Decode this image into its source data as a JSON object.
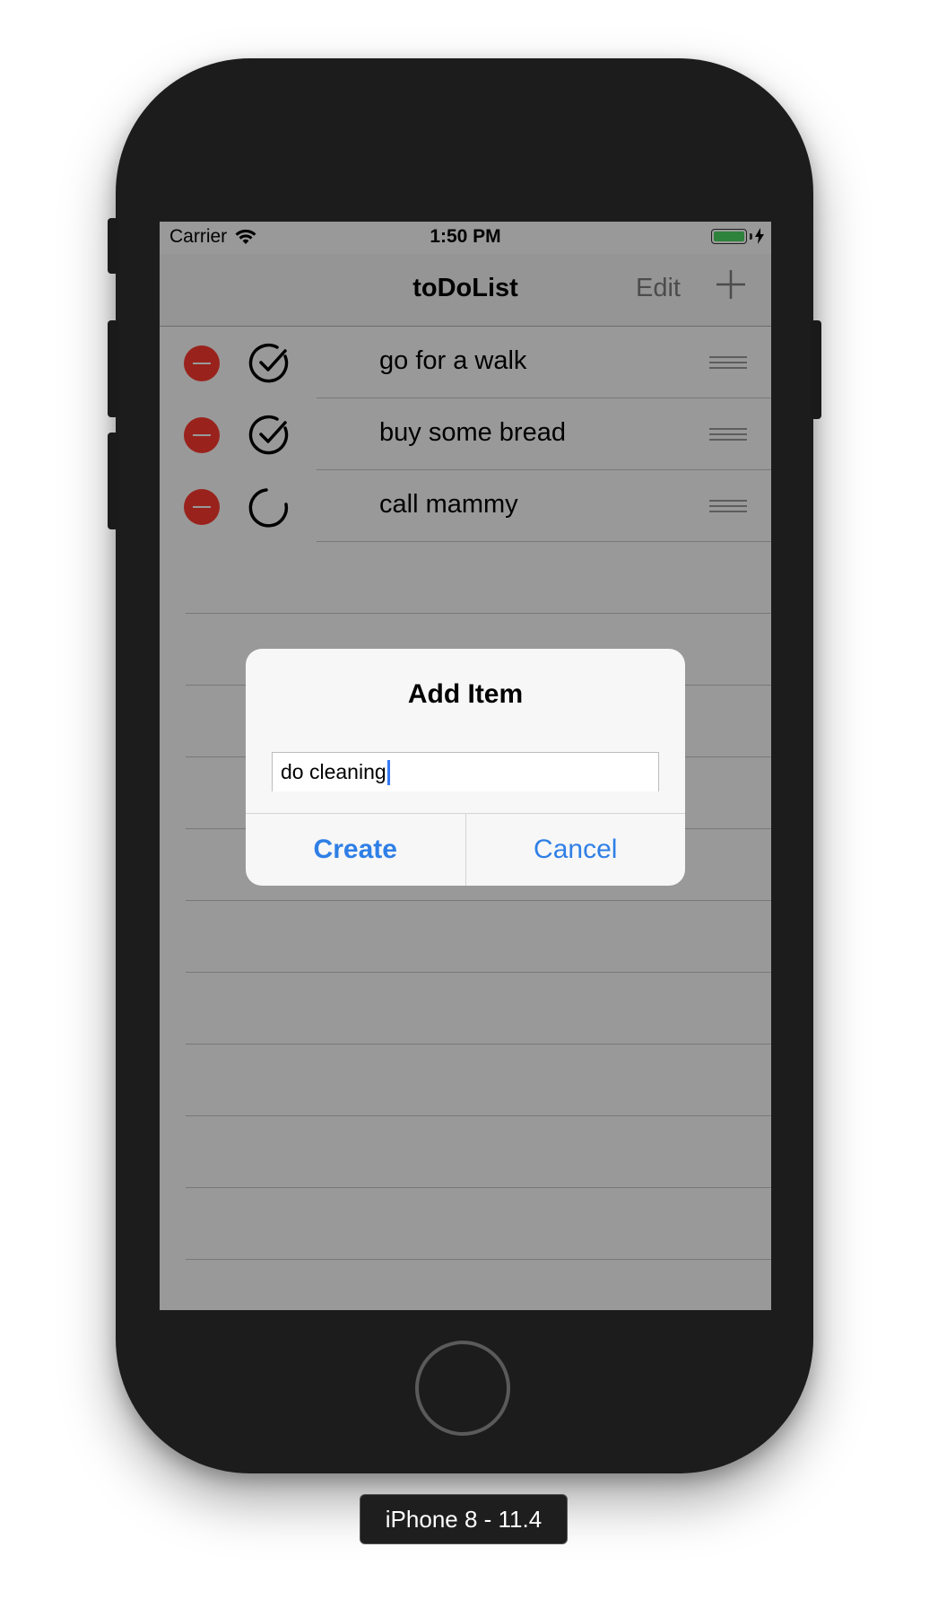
{
  "status_bar": {
    "carrier": "Carrier",
    "time": "1:50 PM",
    "battery_color": "#4cd964"
  },
  "nav": {
    "title": "toDoList",
    "edit_label": "Edit",
    "add_icon": "plus-icon"
  },
  "items": [
    {
      "label": "go for a walk",
      "status": "done",
      "icon": "check-circle-icon"
    },
    {
      "label": "buy some bread",
      "status": "done",
      "icon": "check-circle-icon"
    },
    {
      "label": "call mammy",
      "status": "pending",
      "icon": "open-circle-icon"
    }
  ],
  "alert": {
    "title": "Add Item",
    "input_value": "do cleaning",
    "create_label": "Create",
    "cancel_label": "Cancel"
  },
  "device": {
    "label": "iPhone 8 - 11.4"
  },
  "colors": {
    "accent": "#2f7fe6",
    "delete": "#ff3b30",
    "dim_overlay": "rgba(0,0,0,0.4)"
  }
}
